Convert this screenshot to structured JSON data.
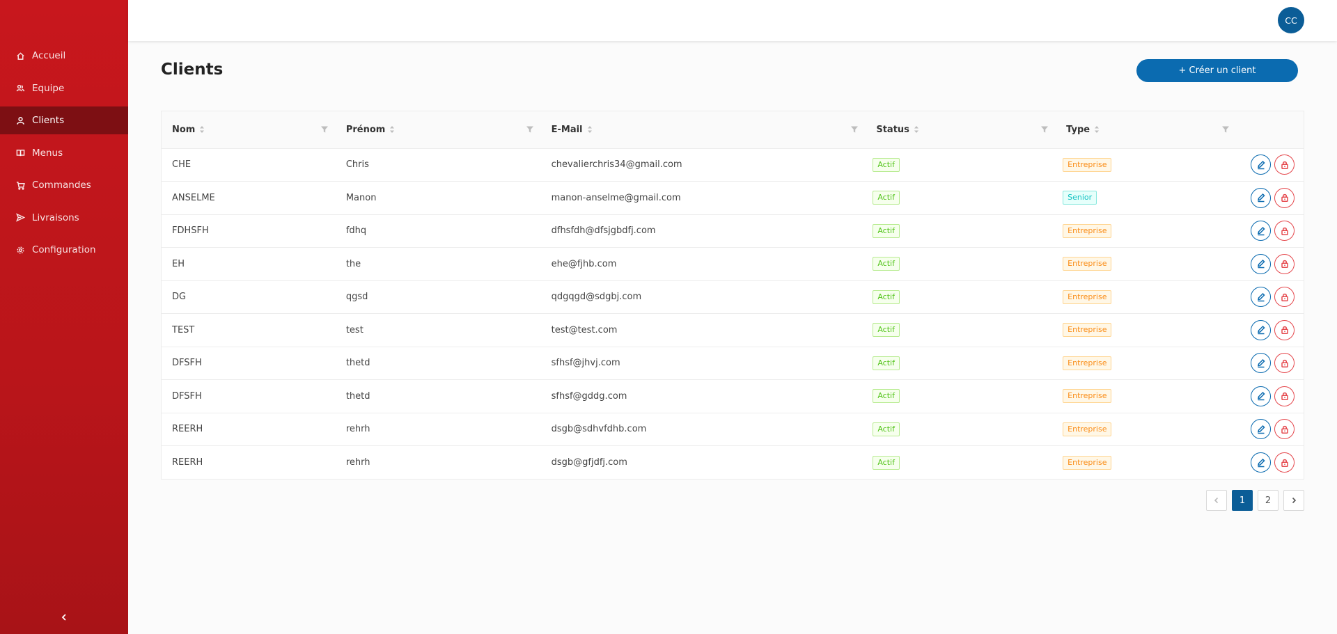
{
  "nav": {
    "items": [
      {
        "label": "Accueil",
        "icon": "home-icon",
        "active": false
      },
      {
        "label": "Equipe",
        "icon": "team-icon",
        "active": false
      },
      {
        "label": "Clients",
        "icon": "user-icon",
        "active": true
      },
      {
        "label": "Menus",
        "icon": "book-icon",
        "active": false
      },
      {
        "label": "Commandes",
        "icon": "cart-icon",
        "active": false
      },
      {
        "label": "Livraisons",
        "icon": "send-icon",
        "active": false
      },
      {
        "label": "Configuration",
        "icon": "gear-icon",
        "active": false
      }
    ]
  },
  "header": {
    "avatar_initials": "CC"
  },
  "page": {
    "title": "Clients",
    "create_label": "+ Créer un client"
  },
  "table": {
    "columns": [
      "Nom",
      "Prénom",
      "E-Mail",
      "Status",
      "Type"
    ],
    "rows": [
      {
        "nom": "CHE",
        "prenom": "Chris",
        "email": "chevalierchris34@gmail.com",
        "status": "Actif",
        "type": "Entreprise"
      },
      {
        "nom": "ANSELME",
        "prenom": "Manon",
        "email": "manon-anselme@gmail.com",
        "status": "Actif",
        "type": "Senior"
      },
      {
        "nom": "FDHSFH",
        "prenom": "fdhq",
        "email": "dfhsfdh@dfsjgbdfj.com",
        "status": "Actif",
        "type": "Entreprise"
      },
      {
        "nom": "EH",
        "prenom": "the",
        "email": "ehe@fjhb.com",
        "status": "Actif",
        "type": "Entreprise"
      },
      {
        "nom": "DG",
        "prenom": "qgsd",
        "email": "qdgqgd@sdgbj.com",
        "status": "Actif",
        "type": "Entreprise"
      },
      {
        "nom": "TEST",
        "prenom": "test",
        "email": "test@test.com",
        "status": "Actif",
        "type": "Entreprise"
      },
      {
        "nom": "DFSFH",
        "prenom": "thetd",
        "email": "sfhsf@jhvj.com",
        "status": "Actif",
        "type": "Entreprise"
      },
      {
        "nom": "DFSFH",
        "prenom": "thetd",
        "email": "sfhsf@gddg.com",
        "status": "Actif",
        "type": "Entreprise"
      },
      {
        "nom": "REERH",
        "prenom": "rehrh",
        "email": "dsgb@sdhvfdhb.com",
        "status": "Actif",
        "type": "Entreprise"
      },
      {
        "nom": "REERH",
        "prenom": "rehrh",
        "email": "dsgb@gfjdfj.com",
        "status": "Actif",
        "type": "Entreprise"
      }
    ]
  },
  "pagination": {
    "pages": [
      "1",
      "2"
    ],
    "current": "1"
  },
  "colors": {
    "sidebar": "#c8171d",
    "sidebar_active": "#7d0f13",
    "primary": "#0b6bb0",
    "danger": "#e5484d"
  }
}
